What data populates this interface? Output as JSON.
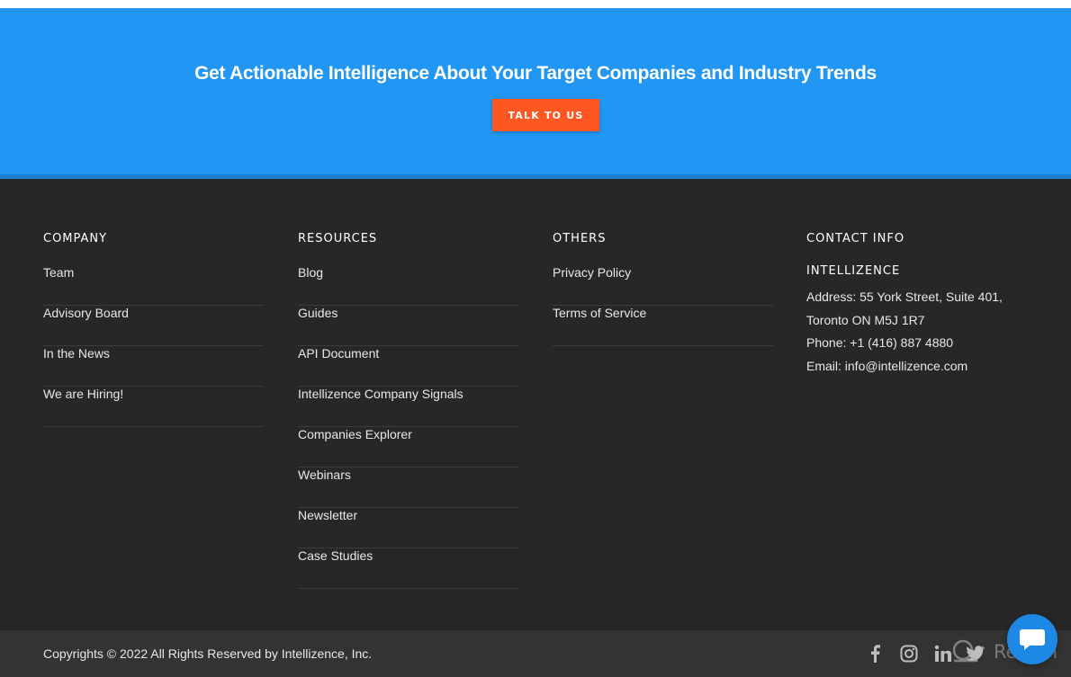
{
  "cta": {
    "title": "Get Actionable Intelligence About Your Target Companies and Industry Trends",
    "button_label": "TALK TO US",
    "background_color": "#2196f3",
    "button_color": "#ff5722"
  },
  "footer": {
    "company": {
      "heading": "COMPANY",
      "links": [
        "Team",
        "Advisory Board",
        "In the News",
        "We are Hiring!"
      ]
    },
    "resources": {
      "heading": "RESOURCES",
      "links": [
        "Blog",
        "Guides",
        "API Document",
        "Intellizence Company Signals",
        "Companies Explorer",
        "Webinars",
        "Newsletter",
        "Case Studies"
      ]
    },
    "others": {
      "heading": "OTHERS",
      "links": [
        "Privacy Policy",
        "Terms of Service"
      ]
    },
    "contact": {
      "heading": "CONTACT INFO",
      "brand": "INTELLIZENCE",
      "address_line1": "Address: 55 York Street, Suite 401,",
      "address_line2": "Toronto ON M5J 1R7",
      "phone": "Phone: +1 (416) 887 4880",
      "email": "Email: info@intellizence.com"
    },
    "copyright": "Copyrights © 2022 All Rights Reserved by Intellizence, Inc.",
    "social_icons": [
      "facebook-icon",
      "instagram-icon",
      "linkedin-icon",
      "twitter-icon"
    ],
    "background_color": "#272727"
  },
  "widgets": {
    "watermark_text": "Revain",
    "chat_icon": "chat-bubble-icon"
  }
}
